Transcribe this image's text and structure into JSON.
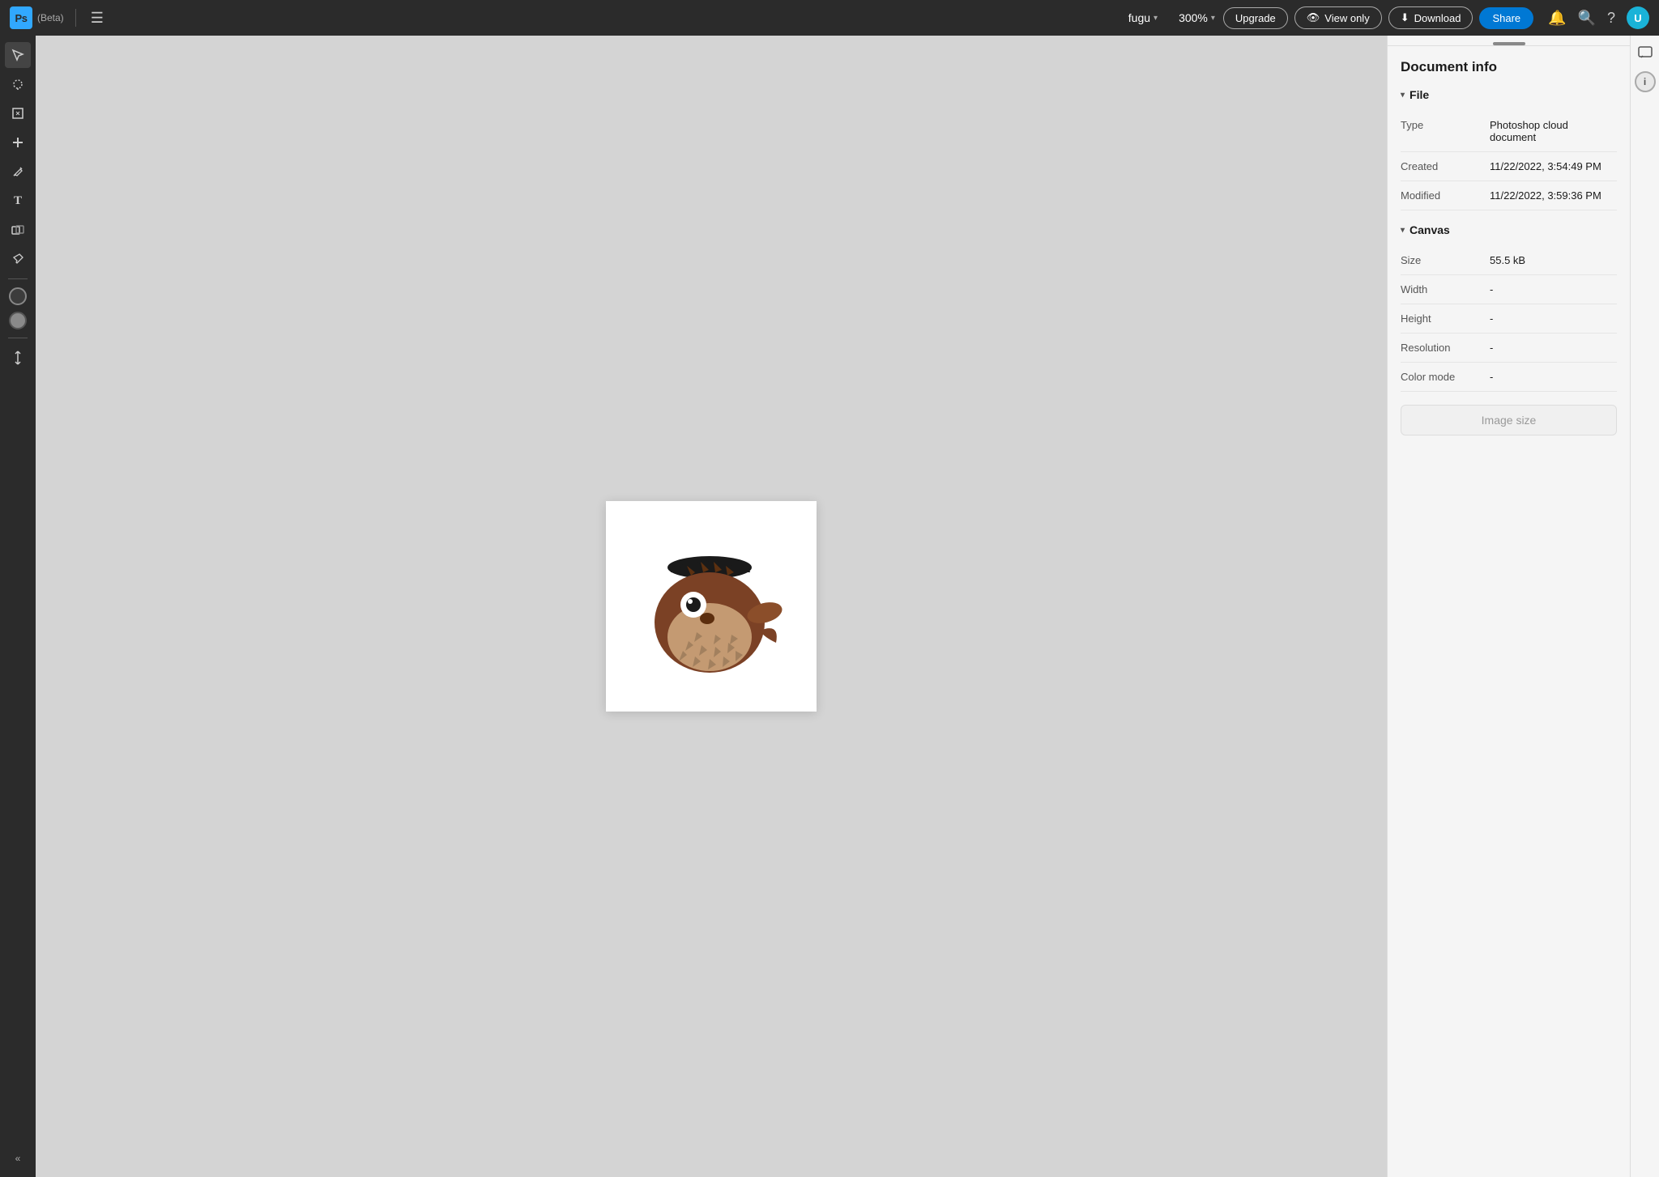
{
  "app": {
    "logo_text": "Ps",
    "beta_label": "(Beta)",
    "hamburger_icon": "☰"
  },
  "topbar": {
    "doc_name": "fugu",
    "zoom": "300%",
    "upgrade_label": "Upgrade",
    "view_only_label": "View only",
    "download_label": "Download",
    "share_label": "Share",
    "eye_icon": "👁",
    "download_icon": "⬇"
  },
  "tools": [
    {
      "name": "select-tool",
      "icon": "↖",
      "active": true
    },
    {
      "name": "lasso-tool",
      "icon": "⊙"
    },
    {
      "name": "transform-tool",
      "icon": "⊞"
    },
    {
      "name": "heal-tool",
      "icon": "✦"
    },
    {
      "name": "brush-tool",
      "icon": "/"
    },
    {
      "name": "text-tool",
      "icon": "T"
    },
    {
      "name": "shape-tool",
      "icon": "⊕"
    },
    {
      "name": "eyedropper-tool",
      "icon": "✒"
    }
  ],
  "panel": {
    "title": "Document info",
    "file_section": "File",
    "canvas_section": "Canvas",
    "file": {
      "type_label": "Type",
      "type_value": "Photoshop cloud document",
      "created_label": "Created",
      "created_value": "11/22/2022, 3:54:49 PM",
      "modified_label": "Modified",
      "modified_value": "11/22/2022, 3:59:36 PM"
    },
    "canvas": {
      "size_label": "Size",
      "size_value": "55.5 kB",
      "width_label": "Width",
      "width_value": "-",
      "height_label": "Height",
      "height_value": "-",
      "resolution_label": "Resolution",
      "resolution_value": "-",
      "color_mode_label": "Color mode",
      "color_mode_value": "-"
    },
    "image_size_button": "Image size"
  },
  "colors": {
    "accent_blue": "#31a8ff",
    "share_blue": "#0078d4"
  }
}
